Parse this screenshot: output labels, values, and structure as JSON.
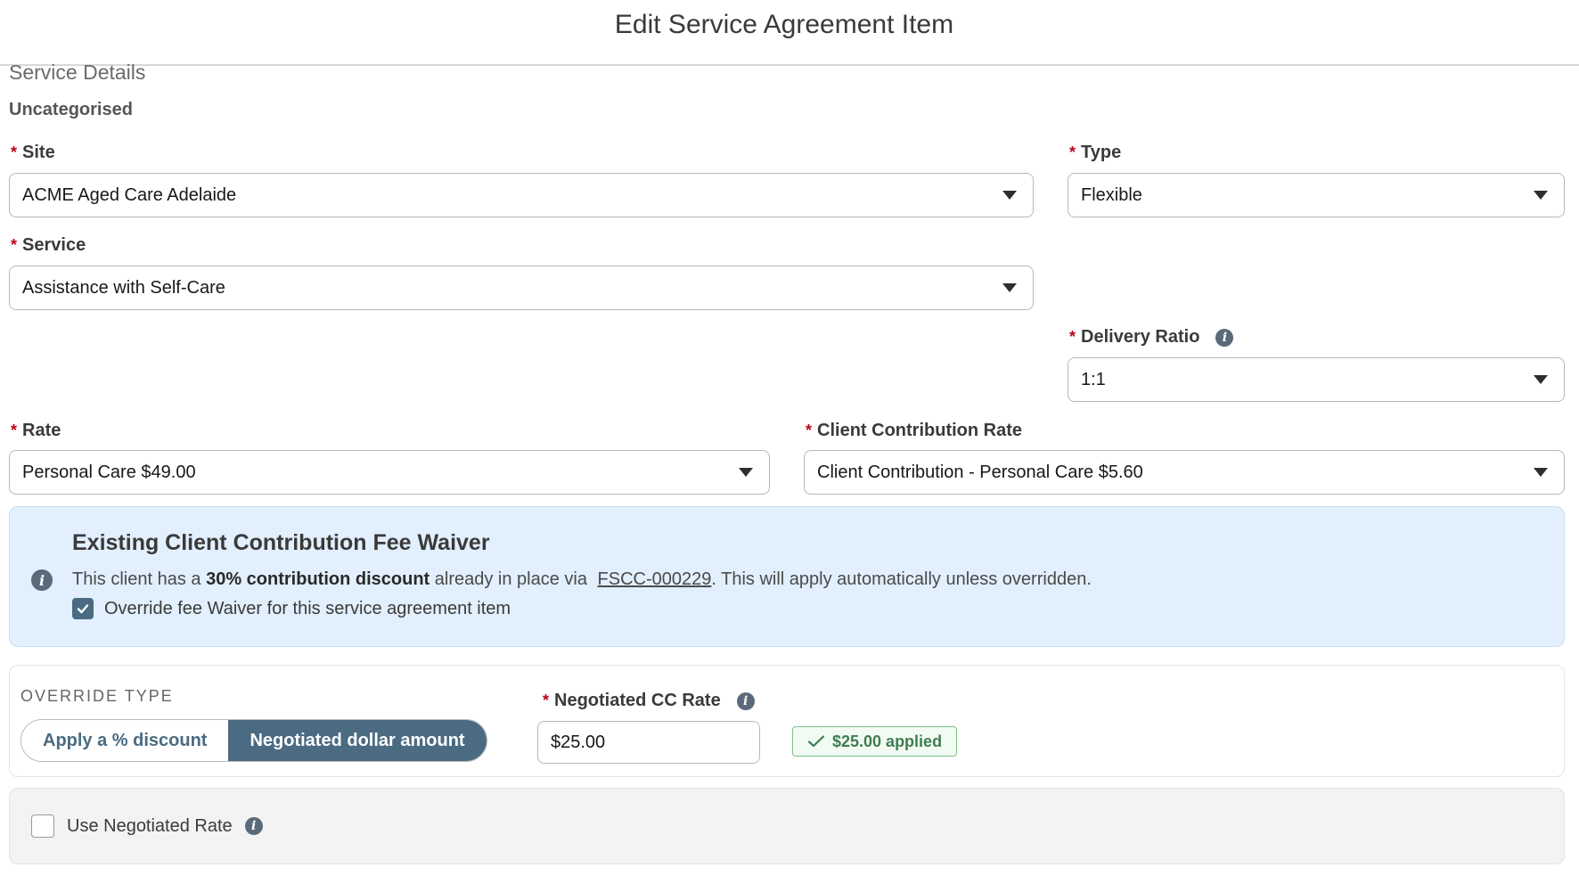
{
  "modal": {
    "title": "Edit Service Agreement Item"
  },
  "section": {
    "heading": "Service Details",
    "subheading": "Uncategorised"
  },
  "fields": {
    "site": {
      "label": "Site",
      "value": "ACME Aged Care Adelaide"
    },
    "type": {
      "label": "Type",
      "value": "Flexible"
    },
    "service": {
      "label": "Service",
      "value": "Assistance with Self-Care"
    },
    "delivery_ratio": {
      "label": "Delivery Ratio",
      "value": "1:1"
    },
    "rate": {
      "label": "Rate",
      "value": "Personal Care $49.00"
    },
    "client_contribution_rate": {
      "label": "Client Contribution Rate",
      "value": "Client Contribution - Personal Care $5.60"
    }
  },
  "required_marker": "*",
  "info_glyph": "i",
  "waiver": {
    "title": "Existing Client Contribution Fee Waiver",
    "text_prefix": "This client has a ",
    "text_bold": "30% contribution discount",
    "text_middle": " already in place via ",
    "link": "FSCC-000229",
    "text_suffix": ". This will apply automatically unless overridden.",
    "override_label": "Override fee Waiver for this service agreement item",
    "override_checked": true
  },
  "override": {
    "type_label": "OVERRIDE TYPE",
    "options": [
      "Apply a % discount",
      "Negotiated dollar amount"
    ],
    "selected_index": 1,
    "negotiated_label": "Negotiated CC Rate",
    "negotiated_value": "$25.00",
    "applied_text": "$25.00 applied"
  },
  "negotiated_rate": {
    "label": "Use Negotiated Rate",
    "checked": false
  },
  "colors": {
    "accent": "#4a6b82",
    "required": "#ba0517",
    "info_bg": "#e2effd",
    "success": "#3f7d4f"
  }
}
